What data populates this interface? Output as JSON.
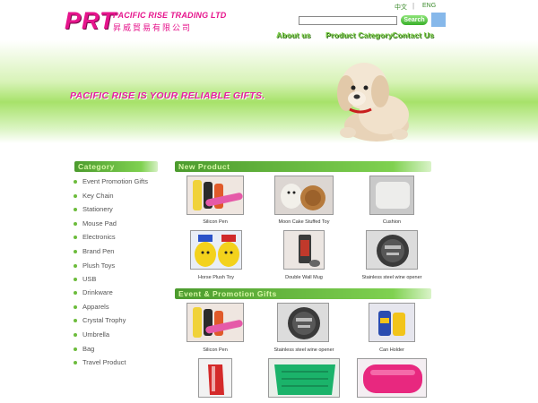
{
  "header": {
    "logo_letters": "PRT",
    "company_name_en": "PACIFIC RISE TRADING LTD",
    "company_name_cn": "昇威貿易有限公司",
    "lang_cn": "中文",
    "lang_sep": "|",
    "lang_en": "ENG",
    "search_placeholder": "",
    "search_button": "Search",
    "nav": [
      "About us",
      "Product Category",
      "Contact Us"
    ]
  },
  "banner": {
    "slogan": "PACIFIC RISE IS YOUR RELIABLE GIFTS."
  },
  "sidebar": {
    "title": "Category",
    "items": [
      "Event Promotion Gifts",
      "Key Chain",
      "Stationery",
      "Mouse Pad",
      "Electronics",
      "Brand Pen",
      "Plush Toys",
      "USB",
      "Drinkware",
      "Apparels",
      "Crystal Trophy",
      "Umbrella",
      "Bag",
      "Travel Product"
    ]
  },
  "new_product": {
    "title": "New Product",
    "items": [
      "Silicon Pen",
      "Moon Cake Stuffed Toy",
      "Cushion",
      "Horse Plush Toy",
      "Double Wall Mug",
      "Stainless steel wine opener"
    ]
  },
  "event_promotion": {
    "title": "Event & Promotion Gifts",
    "items": [
      "Silicon Pen",
      "Stainless steel wine opener",
      "Can Holder",
      "",
      "",
      ""
    ]
  },
  "colors": {
    "brand_pink": "#e6148c",
    "accent_green": "#6cbc3c"
  }
}
